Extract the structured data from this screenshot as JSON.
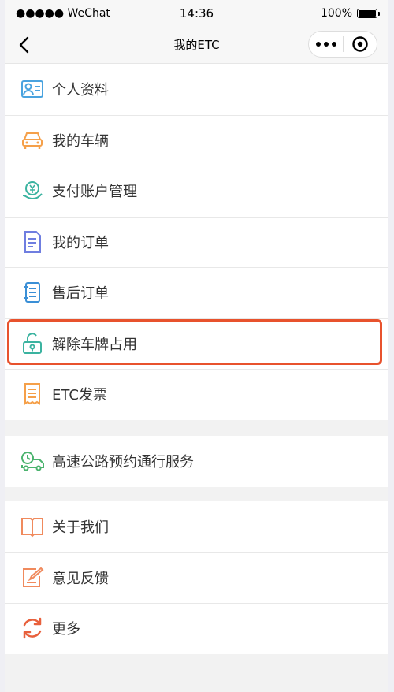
{
  "status_bar": {
    "carrier": "●●●●● WeChat",
    "time": "14:36",
    "battery": "100%"
  },
  "nav": {
    "title": "我的ETC"
  },
  "groups": [
    {
      "items": [
        {
          "label": "个人资料",
          "icon": "profile-card-icon",
          "color": "#4aa3df"
        },
        {
          "label": "我的车辆",
          "icon": "car-icon",
          "color": "#f5a04a"
        },
        {
          "label": "支付账户管理",
          "icon": "yuan-payment-icon",
          "color": "#3bb3a0"
        },
        {
          "label": "我的订单",
          "icon": "order-document-icon",
          "color": "#6f7ee0"
        },
        {
          "label": "售后订单",
          "icon": "after-sale-list-icon",
          "color": "#3a8fd6"
        },
        {
          "label": "解除车牌占用",
          "icon": "unlock-icon",
          "color": "#3bb3a0"
        },
        {
          "label": "ETC发票",
          "icon": "invoice-icon",
          "color": "#f5a04a"
        }
      ]
    },
    {
      "items": [
        {
          "label": "高速公路预约通行服务",
          "icon": "truck-clock-icon",
          "color": "#4bb36e"
        }
      ]
    },
    {
      "items": [
        {
          "label": "关于我们",
          "icon": "book-icon",
          "color": "#f08a5d"
        },
        {
          "label": "意见反馈",
          "icon": "feedback-edit-icon",
          "color": "#f08a5d"
        },
        {
          "label": "更多",
          "icon": "refresh-more-icon",
          "color": "#e8603c"
        }
      ]
    }
  ],
  "colors": {
    "highlight": "#e8522d"
  }
}
